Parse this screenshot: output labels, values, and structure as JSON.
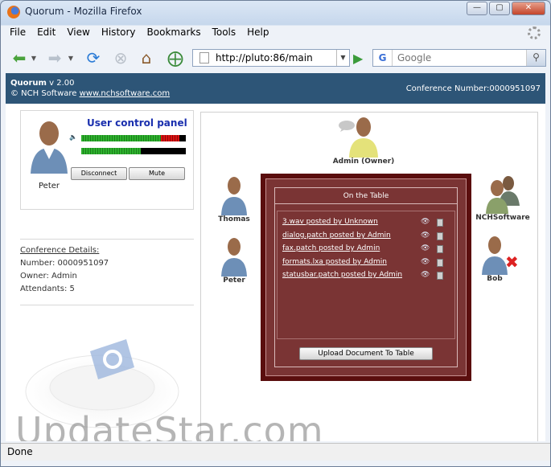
{
  "browser": {
    "window_title": "Quorum - Mozilla Firefox",
    "menu": [
      "File",
      "Edit",
      "View",
      "History",
      "Bookmarks",
      "Tools",
      "Help"
    ],
    "url": "http://pluto:86/main",
    "search_placeholder": "Google",
    "status": "Done"
  },
  "app": {
    "name": "Quorum",
    "version": "v 2.00",
    "copyright": "© NCH Software",
    "website": "www.nchsoftware.com",
    "conference_label": "Conference Number:0000951097"
  },
  "user_panel": {
    "title": "User control panel",
    "user_name": "Peter",
    "disconnect_label": "Disconnect",
    "mute_label": "Mute",
    "mic_level": 0.57,
    "speaker_level": 0.94
  },
  "details": {
    "heading": "Conference Details:",
    "number": "Number: 0000951097",
    "owner": "Owner: Admin",
    "attendants": "Attendants: 5"
  },
  "participants": {
    "admin": "Admin (Owner)",
    "thomas": "Thomas",
    "peter": "Peter",
    "nch": "NCHSoftware",
    "bob": "Bob"
  },
  "table": {
    "title": "On the Table",
    "documents": [
      "3.wav posted by Unknown",
      "dialog.patch posted by Admin",
      "fax.patch posted by Admin",
      "formats.lxa posted by Admin",
      "statusbar.patch posted by Admin"
    ],
    "upload_label": "Upload Document To Table"
  },
  "watermark": "UpdateStar.com"
}
